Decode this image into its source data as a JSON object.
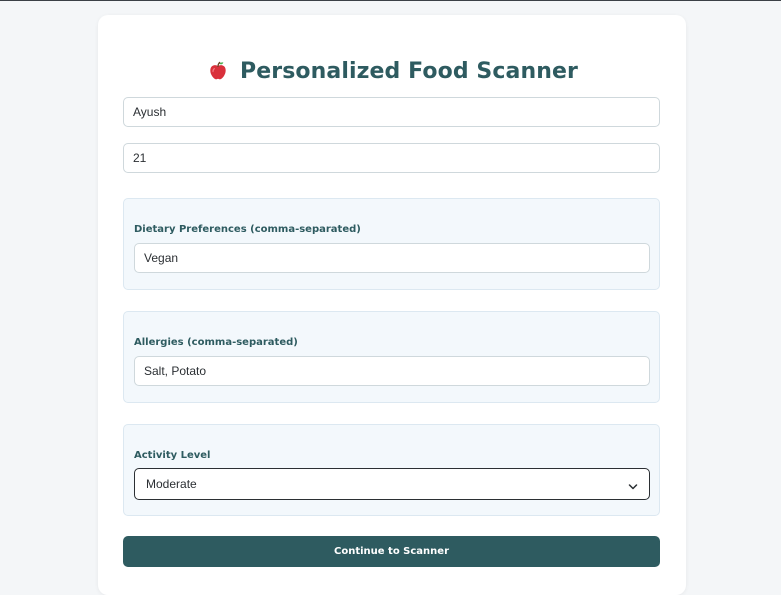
{
  "header": {
    "title": "Personalized Food Scanner",
    "icon": "apple-icon"
  },
  "form": {
    "name": {
      "value": "Ayush"
    },
    "age": {
      "value": "21"
    },
    "dietary": {
      "label": "Dietary Preferences (comma-separated)",
      "value": "Vegan"
    },
    "allergies": {
      "label": "Allergies (comma-separated)",
      "value": "Salt, Potato"
    },
    "activity": {
      "label": "Activity Level",
      "selected": "Moderate",
      "icon": "chevron-down-icon"
    },
    "continue_label": "Continue to Scanner"
  },
  "colors": {
    "accent": "#2e5b60",
    "panel_background": "#f3f8fc",
    "page_background": "#f4f6f8"
  }
}
